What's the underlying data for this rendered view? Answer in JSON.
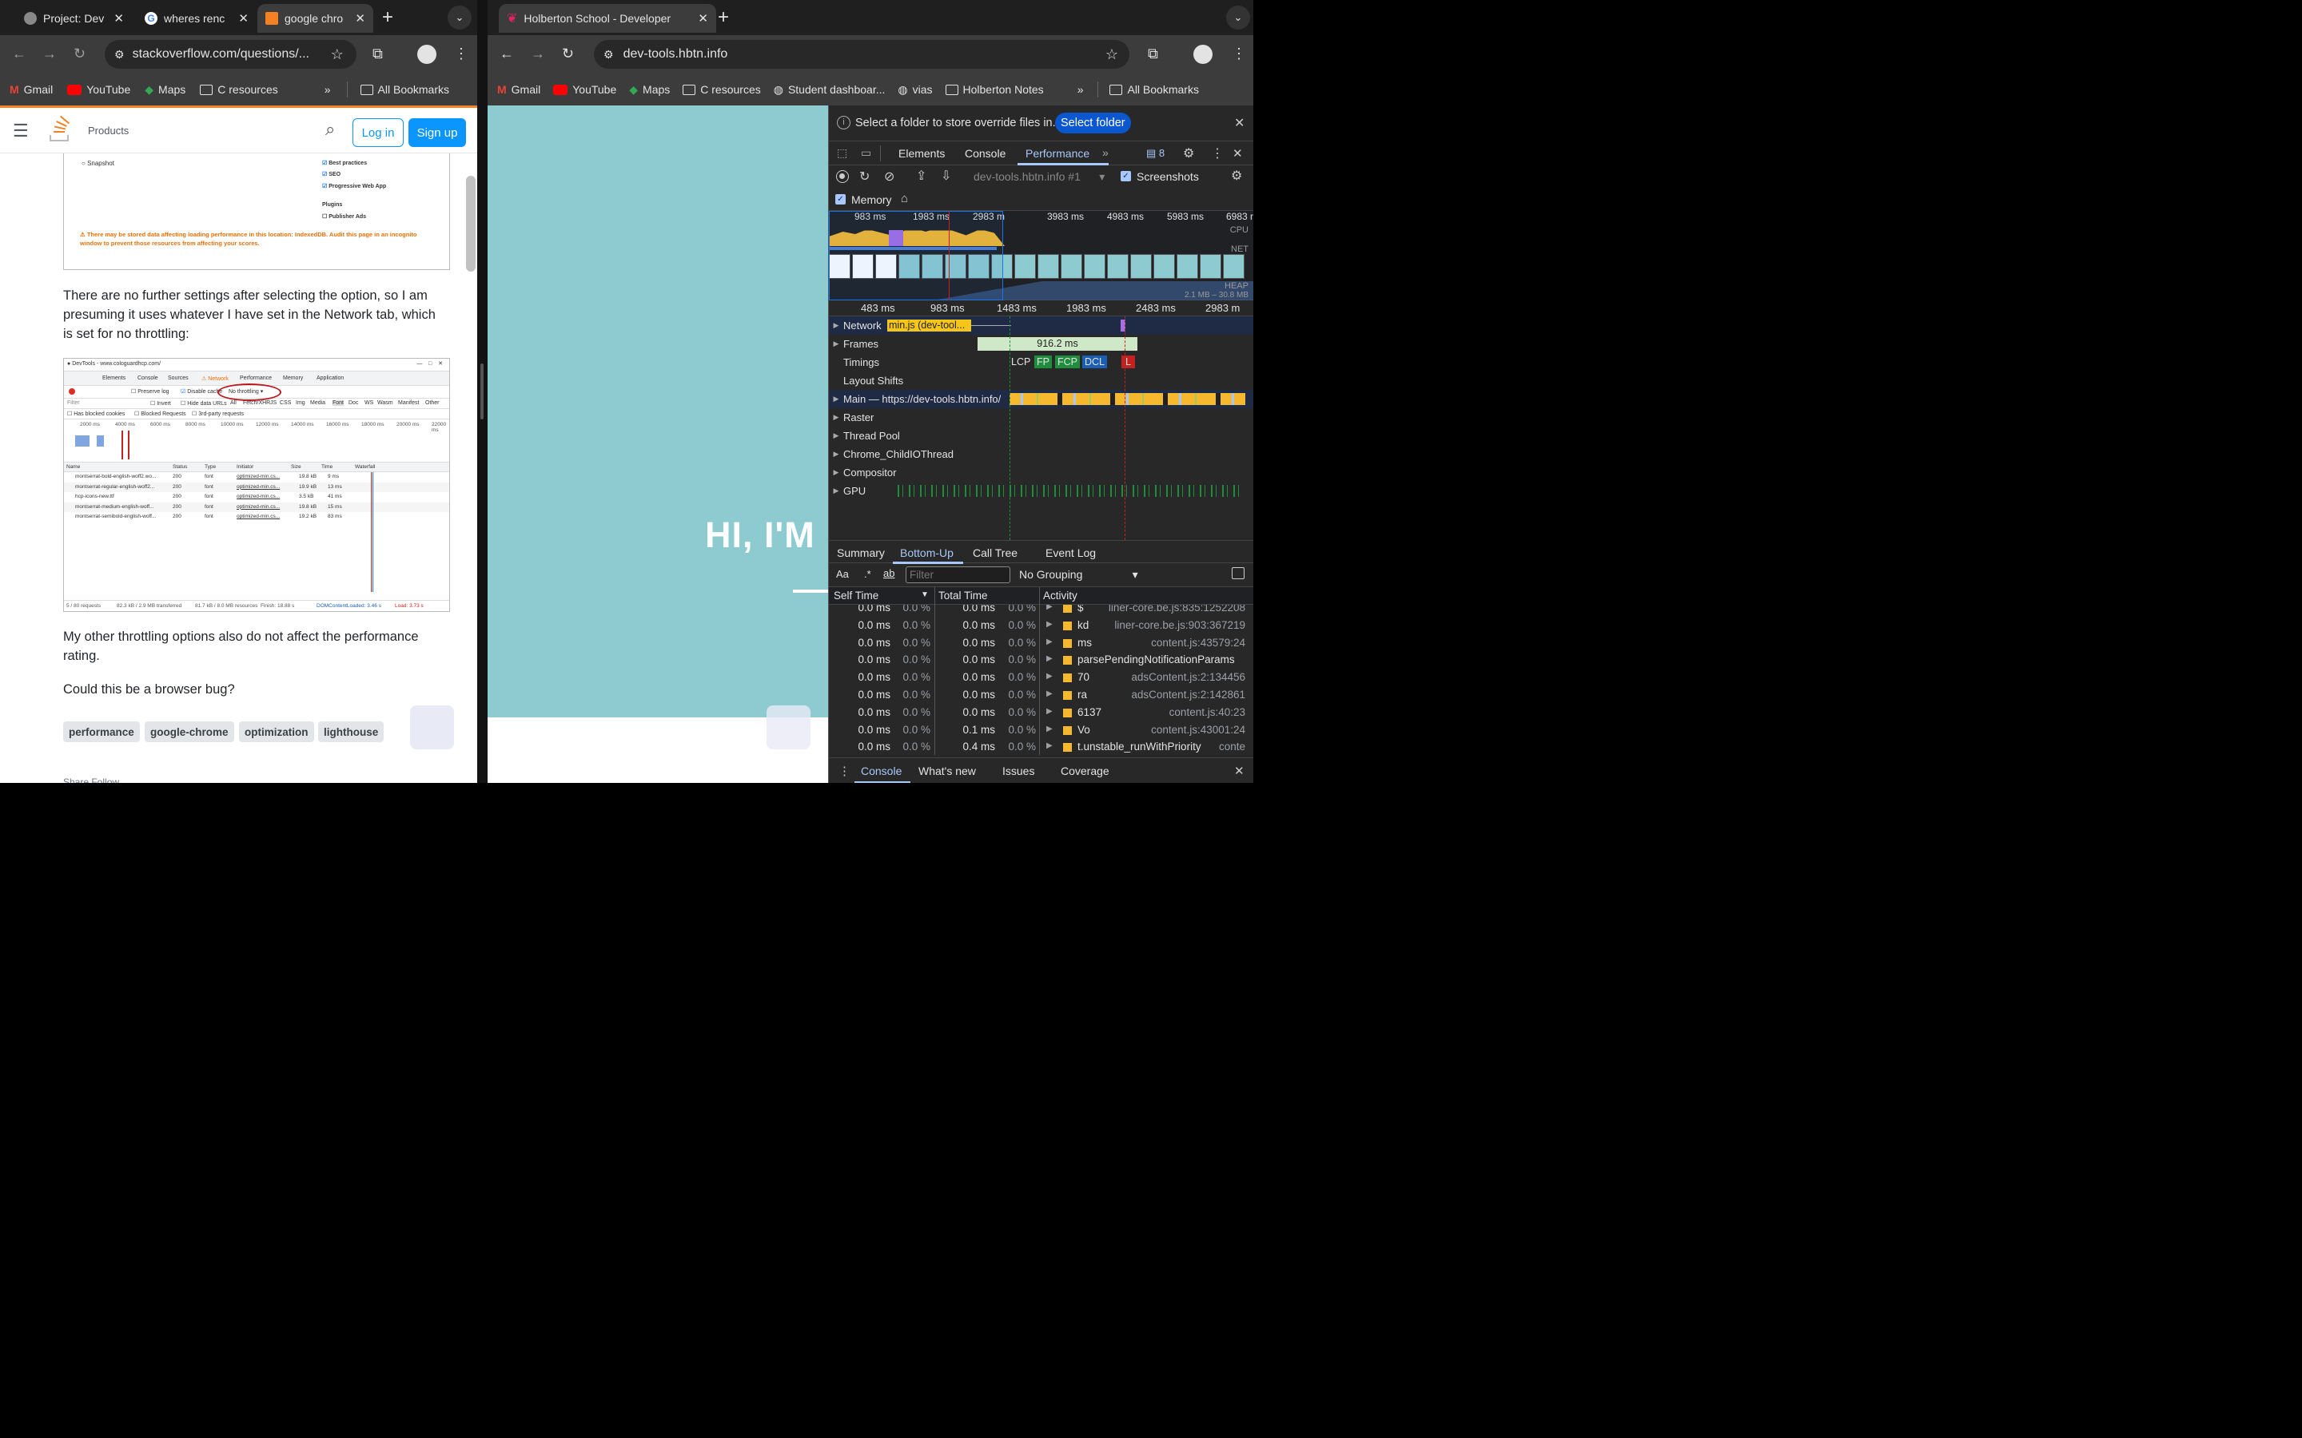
{
  "left_window": {
    "tabs": [
      {
        "title": "Project: Dev"
      },
      {
        "title": "wheres renc"
      },
      {
        "title": "google chro"
      }
    ],
    "url": "stackoverflow.com/questions/...",
    "bookmarks": [
      "Gmail",
      "YouTube",
      "Maps",
      "C resources"
    ],
    "all_bookmarks": "All Bookmarks"
  },
  "stackoverflow": {
    "nav_products": "Products",
    "login": "Log in",
    "signup": "Sign up",
    "lighthouse_shot": {
      "snapshot": "Snapshot",
      "checks": [
        "Best practices",
        "SEO",
        "Progressive Web App"
      ],
      "plugins": "Plugins",
      "publisher_ads": "Publisher Ads",
      "warning": "There may be stored data affecting loading performance in this location: IndexedDB. Audit this page in an incognito window to prevent those resources from affecting your scores."
    },
    "para1": "There are no further settings after selecting the option, so I am presuming it uses whatever I have set in the Network tab, which is set for no throttling:",
    "network_shot": {
      "title": "DevTools - www.cologuardhcp.com/",
      "tabs": [
        "Elements",
        "Console",
        "Sources",
        "Network",
        "Performance",
        "Memory",
        "Application"
      ],
      "preserve_log": "Preserve log",
      "disable_cache": "Disable cache",
      "throttle": "No throttling",
      "filter": "Filter",
      "invert": "Invert",
      "hide_data": "Hide data URLs",
      "types": [
        "All",
        "Fetch/XHR",
        "JS",
        "CSS",
        "Img",
        "Media",
        "Font",
        "Doc",
        "WS",
        "Wasm",
        "Manifest",
        "Other"
      ],
      "blocked_cookies": "Has blocked cookies",
      "blocked_requests": "Blocked Requests",
      "third_party": "3rd-party requests",
      "ticks": [
        "2000 ms",
        "4000 ms",
        "6000 ms",
        "8000 ms",
        "10000 ms",
        "12000 ms",
        "14000 ms",
        "16000 ms",
        "18000 ms",
        "20000 ms",
        "22000 ms"
      ],
      "columns": [
        "Name",
        "Status",
        "Type",
        "Initiator",
        "Size",
        "Time",
        "Waterfall"
      ],
      "rows": [
        [
          "montserrat-bold-english-woff2.wo...",
          "200",
          "font",
          "optimized-min.cs...",
          "19.8 kB",
          "9 ms"
        ],
        [
          "montserrat-regular-english-woff2...",
          "200",
          "font",
          "optimized-min.cs...",
          "19.9 kB",
          "13 ms"
        ],
        [
          "hcp-icons-new.ttf",
          "200",
          "font",
          "optimized-min.cs...",
          "3.5 kB",
          "41 ms"
        ],
        [
          "montserrat-medium-english-woff...",
          "200",
          "font",
          "optimized-min.cs...",
          "19.8 kB",
          "15 ms"
        ],
        [
          "montserrat-semibold-english-woff...",
          "200",
          "font",
          "optimized-min.cs...",
          "19.2 kB",
          "83 ms"
        ]
      ],
      "status": [
        "5 / 80 requests",
        "82.3 kB / 2.9 MB transferred",
        "81.7 kB / 8.0 MB resources",
        "Finish: 18.88 s",
        "DOMContentLoaded: 3.46 s",
        "Load: 3.73 s"
      ]
    },
    "para2": "My other throttling options also do not affect the performance rating.",
    "para3": "Could this be a browser bug?",
    "tags": [
      "performance",
      "google-chrome",
      "optimization",
      "lighthouse"
    ],
    "share": "Share  Follow"
  },
  "right_window": {
    "tab_title": "Holberton School - Developer",
    "url": "dev-tools.hbtn.info",
    "bookmarks": [
      "Gmail",
      "YouTube",
      "Maps",
      "C resources",
      "Student dashboar...",
      "vias",
      "Holberton Notes"
    ],
    "all_bookmarks": "All Bookmarks",
    "hero": "HI, I'M"
  },
  "devtools": {
    "override_msg": "Select a folder to store override files in.",
    "select_folder": "Select folder",
    "panel_tabs": [
      "Elements",
      "Console",
      "Performance"
    ],
    "issues_count": "8",
    "profile": "dev-tools.hbtn.info #1",
    "screenshots": "Screenshots",
    "memory": "Memory",
    "overview_ticks": [
      "983 ms",
      "1983 ms",
      "2983 m",
      "3983 ms",
      "4983 ms",
      "5983 ms",
      "6983 ms"
    ],
    "cpu": "CPU",
    "net": "NET",
    "heap": "HEAP",
    "heap_range": "2.1 MB – 30.8 MB",
    "ruler_ticks": [
      "483 ms",
      "983 ms",
      "1483 ms",
      "1983 ms",
      "2483 ms",
      "2983 m"
    ],
    "network_track": "Network",
    "network_item": "min.js (dev-tool...",
    "frames": "Frames",
    "frame_time": "916.2 ms",
    "timings": "Timings",
    "markers": [
      "LCP",
      "FP",
      "FCP",
      "DCL",
      "L"
    ],
    "tracks": [
      "Layout Shifts",
      "Main — https://dev-tools.hbtn.info/",
      "Raster",
      "Thread Pool",
      "Chrome_ChildIOThread",
      "Compositor",
      "GPU"
    ],
    "bottom_tabs": [
      "Summary",
      "Bottom-Up",
      "Call Tree",
      "Event Log"
    ],
    "filter_placeholder": "Filter",
    "grouping": "No Grouping",
    "columns": [
      "Self Time",
      "Total Time",
      "Activity"
    ],
    "rows": [
      {
        "self": "0.0 ms",
        "self_pct": "0.0 %",
        "total": "0.0 ms",
        "total_pct": "0.0 %",
        "name": "$",
        "src": "liner-core.be.js:835:1252208"
      },
      {
        "self": "0.0 ms",
        "self_pct": "0.0 %",
        "total": "0.0 ms",
        "total_pct": "0.0 %",
        "name": "kd",
        "src": "liner-core.be.js:903:367219"
      },
      {
        "self": "0.0 ms",
        "self_pct": "0.0 %",
        "total": "0.0 ms",
        "total_pct": "0.0 %",
        "name": "ms",
        "src": "content.js:43579:24"
      },
      {
        "self": "0.0 ms",
        "self_pct": "0.0 %",
        "total": "0.0 ms",
        "total_pct": "0.0 %",
        "name": "parsePendingNotificationParams",
        "src": ""
      },
      {
        "self": "0.0 ms",
        "self_pct": "0.0 %",
        "total": "0.0 ms",
        "total_pct": "0.0 %",
        "name": "70",
        "src": "adsContent.js:2:134456"
      },
      {
        "self": "0.0 ms",
        "self_pct": "0.0 %",
        "total": "0.0 ms",
        "total_pct": "0.0 %",
        "name": "ra",
        "src": "adsContent.js:2:142861"
      },
      {
        "self": "0.0 ms",
        "self_pct": "0.0 %",
        "total": "0.0 ms",
        "total_pct": "0.0 %",
        "name": "6137",
        "src": "content.js:40:23"
      },
      {
        "self": "0.0 ms",
        "self_pct": "0.0 %",
        "total": "0.1 ms",
        "total_pct": "0.0 %",
        "name": "Vo",
        "src": "content.js:43001:24"
      },
      {
        "self": "0.0 ms",
        "self_pct": "0.0 %",
        "total": "0.4 ms",
        "total_pct": "0.0 %",
        "name": "t.unstable_runWithPriority",
        "src": "conte"
      }
    ],
    "drawer_tabs": [
      "Console",
      "What's new",
      "Issues",
      "Coverage"
    ]
  }
}
